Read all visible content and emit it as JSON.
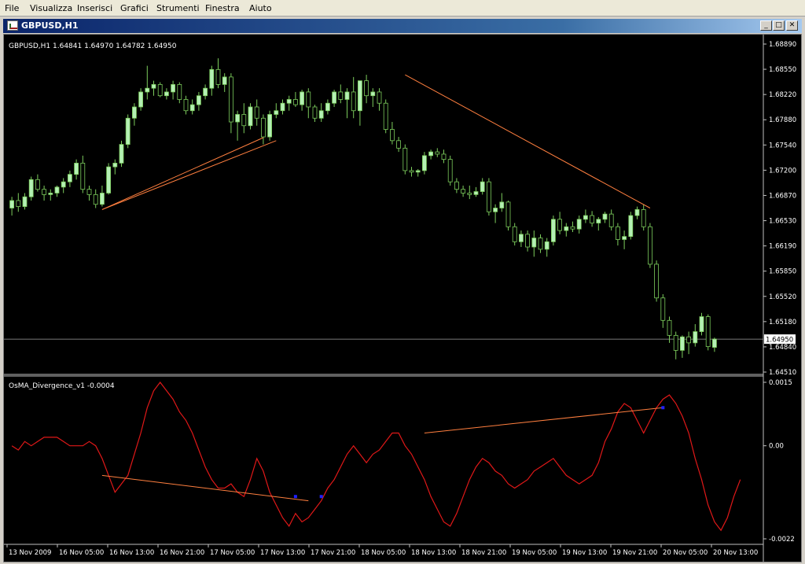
{
  "menu": [
    "File",
    "Visualizza",
    "Inserisci",
    "Grafici",
    "Strumenti",
    "Finestra",
    "Aiuto"
  ],
  "window": {
    "title": "GBPUSD,H1",
    "min_glyph": "_",
    "max_glyph": "□",
    "close_glyph": "✕"
  },
  "colors": {
    "background": "#000000",
    "axis": "#c0c0c0",
    "text": "#ffffff",
    "bull_candle": "#b4f0b4",
    "bear_candle": "#000000",
    "candle_edge": "#7ccc5c",
    "oscillator": "#e01818",
    "divergence_line": "#ff7f3f",
    "marker": "#2020ff"
  },
  "price_panel": {
    "header": "GBPUSD,H1  1.64841 1.64970 1.64782 1.64950",
    "y_ticks": [
      "1.68890",
      "1.68550",
      "1.68220",
      "1.67880",
      "1.67540",
      "1.67200",
      "1.66870",
      "1.66530",
      "1.66190",
      "1.65850",
      "1.65520",
      "1.65180",
      "1.64840",
      "1.64510"
    ],
    "current_price": "1.64950"
  },
  "indicator_panel": {
    "header": "OsMA_Divergence_v1 -0.0004",
    "y_ticks": [
      "0.0015",
      "0.00",
      "-0.0022"
    ]
  },
  "x_ticks": [
    "13 Nov 2009",
    "16 Nov 05:00",
    "16 Nov 13:00",
    "16 Nov 21:00",
    "17 Nov 05:00",
    "17 Nov 13:00",
    "17 Nov 21:00",
    "18 Nov 05:00",
    "18 Nov 13:00",
    "18 Nov 21:00",
    "19 Nov 05:00",
    "19 Nov 13:00",
    "19 Nov 21:00",
    "20 Nov 05:00",
    "20 Nov 13:00"
  ],
  "chart_data": {
    "type": "candlestick",
    "symbol": "GBPUSD",
    "timeframe": "H1",
    "ylim": [
      1.6451,
      1.6889
    ],
    "candles": [
      [
        1.667,
        1.6685,
        1.666,
        1.668
      ],
      [
        1.668,
        1.669,
        1.6665,
        1.6672
      ],
      [
        1.6672,
        1.669,
        1.6668,
        1.6685
      ],
      [
        1.6685,
        1.6712,
        1.668,
        1.6708
      ],
      [
        1.6708,
        1.6715,
        1.6692,
        1.6695
      ],
      [
        1.6695,
        1.67,
        1.668,
        1.6688
      ],
      [
        1.6688,
        1.6695,
        1.668,
        1.669
      ],
      [
        1.669,
        1.67,
        1.6685,
        1.6698
      ],
      [
        1.6698,
        1.671,
        1.669,
        1.6705
      ],
      [
        1.6705,
        1.672,
        1.6698,
        1.6715
      ],
      [
        1.6715,
        1.6735,
        1.6708,
        1.673
      ],
      [
        1.673,
        1.674,
        1.669,
        1.6695
      ],
      [
        1.6695,
        1.67,
        1.668,
        1.6688
      ],
      [
        1.6688,
        1.6695,
        1.667,
        1.6675
      ],
      [
        1.6675,
        1.67,
        1.6672,
        1.669
      ],
      [
        1.669,
        1.673,
        1.6688,
        1.6725
      ],
      [
        1.6725,
        1.6735,
        1.6715,
        1.673
      ],
      [
        1.673,
        1.676,
        1.6725,
        1.6755
      ],
      [
        1.6755,
        1.6795,
        1.675,
        1.679
      ],
      [
        1.679,
        1.681,
        1.678,
        1.6805
      ],
      [
        1.6805,
        1.683,
        1.68,
        1.6825
      ],
      [
        1.6825,
        1.686,
        1.6815,
        1.683
      ],
      [
        1.683,
        1.684,
        1.682,
        1.6835
      ],
      [
        1.6835,
        1.6838,
        1.6818,
        1.682
      ],
      [
        1.682,
        1.683,
        1.6815,
        1.6825
      ],
      [
        1.6825,
        1.684,
        1.6815,
        1.6835
      ],
      [
        1.6835,
        1.6838,
        1.681,
        1.6815
      ],
      [
        1.6815,
        1.682,
        1.6795,
        1.68
      ],
      [
        1.68,
        1.6815,
        1.6795,
        1.6808
      ],
      [
        1.6808,
        1.6825,
        1.68,
        1.682
      ],
      [
        1.682,
        1.6835,
        1.6815,
        1.683
      ],
      [
        1.683,
        1.686,
        1.682,
        1.6855
      ],
      [
        1.6855,
        1.687,
        1.683,
        1.6835
      ],
      [
        1.6835,
        1.685,
        1.6825,
        1.6845
      ],
      [
        1.6845,
        1.685,
        1.677,
        1.6785
      ],
      [
        1.6785,
        1.68,
        1.676,
        1.6795
      ],
      [
        1.6795,
        1.681,
        1.677,
        1.678
      ],
      [
        1.678,
        1.681,
        1.6775,
        1.6805
      ],
      [
        1.6805,
        1.6815,
        1.678,
        1.679
      ],
      [
        1.679,
        1.6795,
        1.6755,
        1.6765
      ],
      [
        1.6765,
        1.68,
        1.676,
        1.6795
      ],
      [
        1.6795,
        1.681,
        1.679,
        1.68
      ],
      [
        1.68,
        1.6815,
        1.6795,
        1.681
      ],
      [
        1.681,
        1.682,
        1.68,
        1.6815
      ],
      [
        1.6815,
        1.6825,
        1.6805,
        1.6808
      ],
      [
        1.6808,
        1.6828,
        1.68,
        1.6825
      ],
      [
        1.6825,
        1.683,
        1.679,
        1.6805
      ],
      [
        1.6805,
        1.6808,
        1.6785,
        1.679
      ],
      [
        1.679,
        1.681,
        1.6785,
        1.68
      ],
      [
        1.68,
        1.6815,
        1.6795,
        1.681
      ],
      [
        1.681,
        1.6828,
        1.6805,
        1.6825
      ],
      [
        1.6825,
        1.6835,
        1.681,
        1.6815
      ],
      [
        1.6815,
        1.683,
        1.679,
        1.6825
      ],
      [
        1.6825,
        1.6845,
        1.679,
        1.68
      ],
      [
        1.68,
        1.684,
        1.678,
        1.684
      ],
      [
        1.684,
        1.6848,
        1.681,
        1.682
      ],
      [
        1.682,
        1.683,
        1.6805,
        1.6825
      ],
      [
        1.6825,
        1.683,
        1.68,
        1.681
      ],
      [
        1.681,
        1.6815,
        1.677,
        1.6775
      ],
      [
        1.6775,
        1.6785,
        1.6755,
        1.676
      ],
      [
        1.676,
        1.6765,
        1.6745,
        1.675
      ],
      [
        1.675,
        1.6755,
        1.6715,
        1.672
      ],
      [
        1.672,
        1.6725,
        1.6712,
        1.6718
      ],
      [
        1.6718,
        1.6722,
        1.6712,
        1.672
      ],
      [
        1.672,
        1.6745,
        1.6715,
        1.674
      ],
      [
        1.674,
        1.6748,
        1.6735,
        1.6745
      ],
      [
        1.6745,
        1.675,
        1.6738,
        1.6742
      ],
      [
        1.6742,
        1.6748,
        1.673,
        1.6735
      ],
      [
        1.6735,
        1.674,
        1.67,
        1.6705
      ],
      [
        1.6705,
        1.671,
        1.669,
        1.6695
      ],
      [
        1.6695,
        1.67,
        1.6685,
        1.669
      ],
      [
        1.669,
        1.67,
        1.6682,
        1.6688
      ],
      [
        1.6688,
        1.6698,
        1.6685,
        1.6692
      ],
      [
        1.6692,
        1.671,
        1.6688,
        1.6705
      ],
      [
        1.6705,
        1.671,
        1.666,
        1.6665
      ],
      [
        1.6665,
        1.6675,
        1.665,
        1.667
      ],
      [
        1.667,
        1.669,
        1.6665,
        1.6678
      ],
      [
        1.6678,
        1.668,
        1.664,
        1.6645
      ],
      [
        1.6645,
        1.665,
        1.662,
        1.6625
      ],
      [
        1.6625,
        1.664,
        1.6618,
        1.6635
      ],
      [
        1.6635,
        1.664,
        1.6612,
        1.6618
      ],
      [
        1.6618,
        1.664,
        1.6605,
        1.663
      ],
      [
        1.663,
        1.6635,
        1.661,
        1.6615
      ],
      [
        1.6615,
        1.663,
        1.6605,
        1.6625
      ],
      [
        1.6625,
        1.666,
        1.662,
        1.6655
      ],
      [
        1.6655,
        1.6665,
        1.6635,
        1.664
      ],
      [
        1.664,
        1.665,
        1.6632,
        1.6645
      ],
      [
        1.6645,
        1.6652,
        1.6638,
        1.6642
      ],
      [
        1.6642,
        1.666,
        1.6636,
        1.6655
      ],
      [
        1.6655,
        1.6668,
        1.665,
        1.666
      ],
      [
        1.666,
        1.6666,
        1.6645,
        1.665
      ],
      [
        1.665,
        1.6658,
        1.664,
        1.6655
      ],
      [
        1.6655,
        1.6665,
        1.665,
        1.6662
      ],
      [
        1.6662,
        1.6668,
        1.664,
        1.6645
      ],
      [
        1.6645,
        1.665,
        1.662,
        1.6628
      ],
      [
        1.6628,
        1.664,
        1.6615,
        1.6632
      ],
      [
        1.6632,
        1.6665,
        1.6628,
        1.666
      ],
      [
        1.666,
        1.6672,
        1.6655,
        1.6668
      ],
      [
        1.6668,
        1.6675,
        1.664,
        1.6645
      ],
      [
        1.6645,
        1.665,
        1.659,
        1.6595
      ],
      [
        1.6595,
        1.66,
        1.6545,
        1.655
      ],
      [
        1.655,
        1.6555,
        1.651,
        1.652
      ],
      [
        1.652,
        1.6525,
        1.649,
        1.65
      ],
      [
        1.65,
        1.6505,
        1.6468,
        1.648
      ],
      [
        1.648,
        1.65,
        1.647,
        1.6498
      ],
      [
        1.6498,
        1.6505,
        1.6475,
        1.649
      ],
      [
        1.649,
        1.6515,
        1.6485,
        1.6505
      ],
      [
        1.6505,
        1.653,
        1.65,
        1.6525
      ],
      [
        1.6525,
        1.6528,
        1.648,
        1.6485
      ],
      [
        1.6484,
        1.6497,
        1.6478,
        1.6495
      ]
    ],
    "price_divergence_lines": [
      {
        "from": [
          14,
          1.6668
        ],
        "to": [
          39,
          1.6764
        ]
      },
      {
        "from": [
          14,
          1.6668
        ],
        "to": [
          41,
          1.676
        ]
      },
      {
        "from": [
          61,
          1.6848
        ],
        "to": [
          99,
          1.667
        ]
      }
    ],
    "oscillator": {
      "name": "OsMA_Divergence_v1",
      "ylim": [
        -0.0022,
        0.0015
      ],
      "values": [
        0.0,
        -0.0001,
        0.0001,
        0.0,
        0.0001,
        0.0002,
        0.0002,
        0.0002,
        0.0001,
        0.0,
        0.0,
        0.0,
        0.0001,
        0.0,
        -0.0003,
        -0.0007,
        -0.0011,
        -0.0009,
        -0.0007,
        -0.0002,
        0.0003,
        0.0009,
        0.0013,
        0.0015,
        0.0013,
        0.0011,
        0.0008,
        0.0006,
        0.0003,
        -0.0001,
        -0.0005,
        -0.0008,
        -0.001,
        -0.001,
        -0.0009,
        -0.0011,
        -0.0012,
        -0.0008,
        -0.0003,
        -0.0006,
        -0.0011,
        -0.0014,
        -0.0017,
        -0.0019,
        -0.0016,
        -0.0018,
        -0.0017,
        -0.0015,
        -0.0013,
        -0.001,
        -0.0008,
        -0.0005,
        -0.0002,
        0.0,
        -0.0002,
        -0.0004,
        -0.0002,
        -0.0001,
        0.0001,
        0.0003,
        0.0003,
        0.0,
        -0.0002,
        -0.0005,
        -0.0008,
        -0.0012,
        -0.0015,
        -0.0018,
        -0.0019,
        -0.0016,
        -0.0012,
        -0.0008,
        -0.0005,
        -0.0003,
        -0.0004,
        -0.0006,
        -0.0007,
        -0.0009,
        -0.001,
        -0.0009,
        -0.0008,
        -0.0006,
        -0.0005,
        -0.0004,
        -0.0003,
        -0.0005,
        -0.0007,
        -0.0008,
        -0.0009,
        -0.0008,
        -0.0007,
        -0.0004,
        0.0001,
        0.0004,
        0.0008,
        0.001,
        0.0009,
        0.0006,
        0.0003,
        0.0006,
        0.0009,
        0.0011,
        0.0012,
        0.001,
        0.0007,
        0.0003,
        -0.0003,
        -0.0008,
        -0.0014,
        -0.0018,
        -0.002,
        -0.0017,
        -0.0012,
        -0.0008
      ]
    },
    "oscillator_divergence_lines": [
      {
        "from": [
          14,
          -0.0007
        ],
        "to": [
          46,
          -0.0013
        ]
      },
      {
        "from": [
          64,
          0.0003
        ],
        "to": [
          101,
          0.0009
        ]
      }
    ],
    "oscillator_markers": [
      [
        44,
        -0.0012
      ],
      [
        48,
        -0.0012
      ],
      [
        101,
        0.0009
      ]
    ]
  }
}
